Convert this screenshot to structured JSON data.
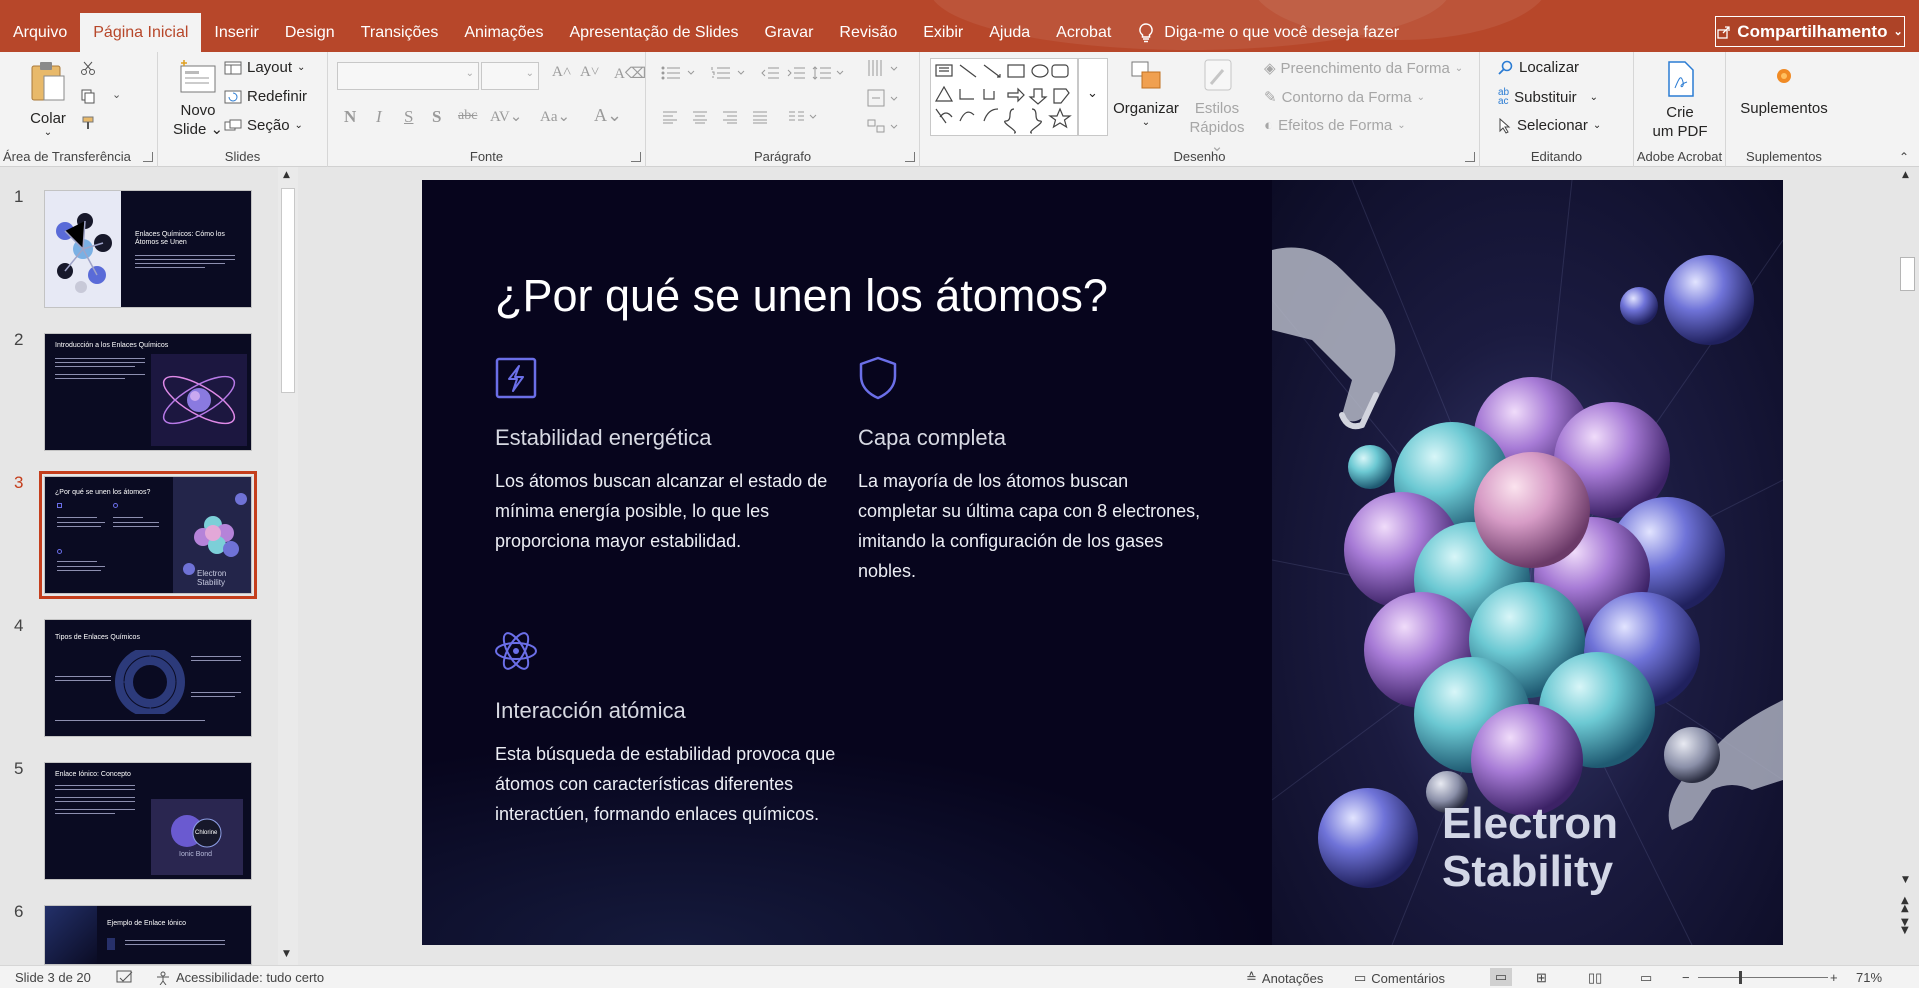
{
  "ribbon_tabs": [
    "Arquivo",
    "Página Inicial",
    "Inserir",
    "Design",
    "Transições",
    "Animações",
    "Apresentação de Slides",
    "Gravar",
    "Revisão",
    "Exibir",
    "Ajuda",
    "Acrobat"
  ],
  "tell_me": "Diga-me o que você deseja fazer",
  "share_label": "Compartilhamento",
  "accent_color": "#b7472a",
  "clipboard": {
    "paste": "Colar",
    "group": "Área de Transferência"
  },
  "slides_group": {
    "new_slide_line1": "Novo",
    "new_slide_line2": "Slide",
    "layout": "Layout",
    "reset": "Redefinir",
    "section": "Seção",
    "group": "Slides"
  },
  "font_group": {
    "group": "Fonte"
  },
  "paragraph_group": {
    "group": "Parágrafo"
  },
  "drawing_group": {
    "arrange": "Organizar",
    "quick_styles_line1": "Estilos",
    "quick_styles_line2": "Rápidos",
    "shape_fill": "Preenchimento da Forma",
    "shape_outline": "Contorno da Forma",
    "shape_effects": "Efeitos de Forma",
    "group": "Desenho"
  },
  "editing_group": {
    "find": "Localizar",
    "replace": "Substituir",
    "select": "Selecionar",
    "group": "Editando"
  },
  "acrobat_group": {
    "create_line1": "Crie",
    "create_line2": "um PDF",
    "group": "Adobe Acrobat"
  },
  "addins_group": {
    "button": "Suplementos",
    "group": "Suplementos"
  },
  "thumbnails": [
    {
      "num": "1",
      "title": "Enlaces Químicos: Cómo los Átomos se Unen"
    },
    {
      "num": "2",
      "title": "Introducción a los Enlaces Químicos"
    },
    {
      "num": "3",
      "title": "¿Por qué se unen los átomos?",
      "art_label": "Electron Stability"
    },
    {
      "num": "4",
      "title": "Tipos de Enlaces Químicos"
    },
    {
      "num": "5",
      "title": "Enlace Iónico: Concepto",
      "art_label1": "Chlorine",
      "art_label2": "Ionic Bond"
    },
    {
      "num": "6",
      "title": "Ejemplo de Enlace Iónico"
    }
  ],
  "slide": {
    "title": "¿Por qué se unen los átomos?",
    "features": [
      {
        "icon": "lightning-icon",
        "title": "Estabilidad energética",
        "desc": "Los átomos buscan alcanzar el estado de mínima energía posible, lo que les proporciona mayor estabilidad."
      },
      {
        "icon": "shield-icon",
        "title": "Capa completa",
        "desc": "La mayoría de los átomos buscan completar su última capa con 8 electrones, imitando la configuración de los gases nobles."
      },
      {
        "icon": "atom-icon",
        "title": "Interacción atómica",
        "desc": "Esta búsqueda de estabilidad provoca que átomos con características diferentes interactúen, formando enlaces químicos."
      }
    ],
    "art_text_line1": "Electron",
    "art_text_line2": "Stability"
  },
  "status": {
    "slide_count": "Slide 3 de 20",
    "accessibility": "Acessibilidade: tudo certo",
    "notes": "Anotações",
    "comments": "Comentários",
    "zoom": "71%"
  }
}
